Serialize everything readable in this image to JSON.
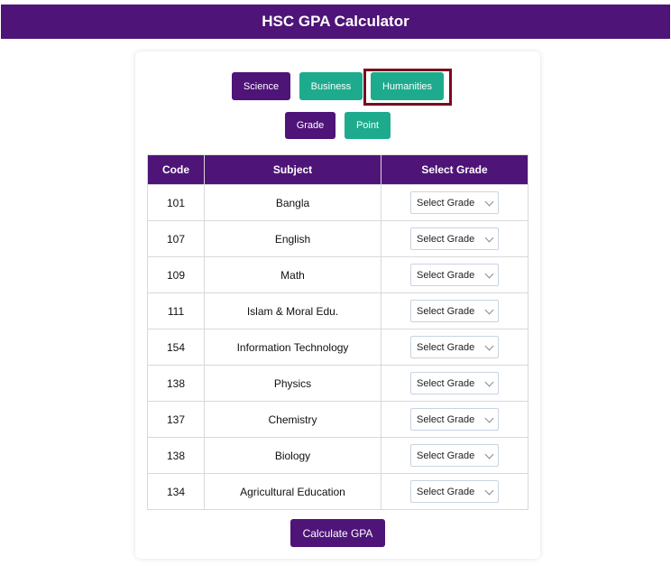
{
  "header": {
    "title": "HSC GPA Calculator"
  },
  "groups": {
    "science": "Science",
    "business": "Business",
    "humanities": "Humanities"
  },
  "modes": {
    "grade": "Grade",
    "point": "Point"
  },
  "table": {
    "headers": [
      "Code",
      "Subject",
      "Select Grade"
    ],
    "rows": [
      {
        "code": "101",
        "subject": "Bangla",
        "grade": "Select Grade"
      },
      {
        "code": "107",
        "subject": "English",
        "grade": "Select Grade"
      },
      {
        "code": "109",
        "subject": "Math",
        "grade": "Select Grade"
      },
      {
        "code": "111",
        "subject": "Islam & Moral Edu.",
        "grade": "Select Grade"
      },
      {
        "code": "154",
        "subject": "Information Technology",
        "grade": "Select Grade"
      },
      {
        "code": "138",
        "subject": "Physics",
        "grade": "Select Grade"
      },
      {
        "code": "137",
        "subject": "Chemistry",
        "grade": "Select Grade"
      },
      {
        "code": "138",
        "subject": "Biology",
        "grade": "Select Grade"
      },
      {
        "code": "134",
        "subject": "Agricultural Education",
        "grade": "Select Grade"
      }
    ]
  },
  "actions": {
    "calculate": "Calculate GPA"
  },
  "colors": {
    "primary": "#4e1478",
    "accent": "#1eab8d",
    "highlight": "#7a0a1e"
  }
}
